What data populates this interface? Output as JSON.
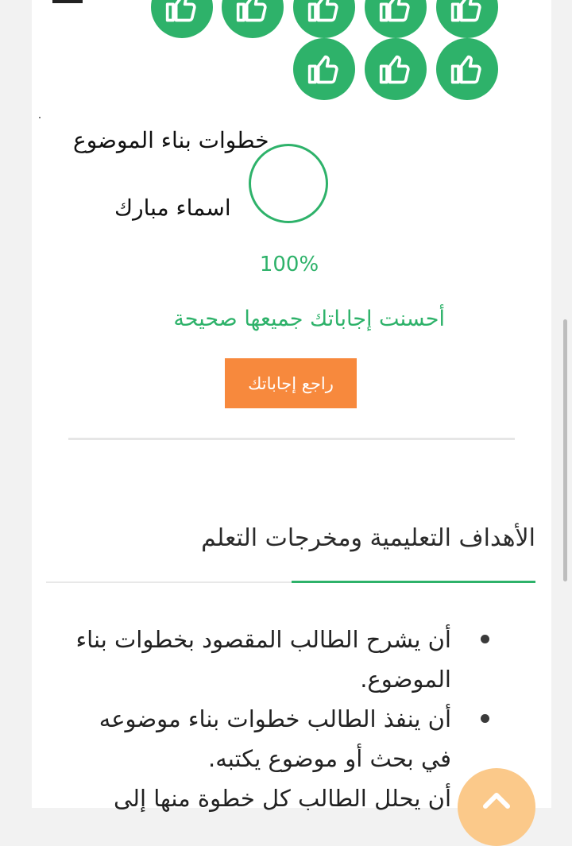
{
  "handwritten": {
    "line1": "خطوات بناء الموضوع",
    "line2": "اسماء مبارك"
  },
  "result": {
    "percent": "100%",
    "message": "أحسنت إجاباتك جميعها صحيحة",
    "review_button": "راجع إجاباتك"
  },
  "objectives": {
    "title": "الأهداف التعليمية ومخرجات التعلم",
    "items": [
      "أن يشرح الطالب المقصود بخطوات بناء الموضوع.",
      "أن ينفذ الطالب خطوات بناء موضوعه في بحث أو موضوع يكتبه.",
      "أن يحلل الطالب كل خطوة منها إلى"
    ]
  },
  "colors": {
    "accent_green": "#2eb26a",
    "button_orange": "#f7893d",
    "scroll_button": "#fbc98a"
  },
  "icons": {
    "badge": "thumbs-up-icon",
    "scroll": "chevron-up-icon"
  }
}
